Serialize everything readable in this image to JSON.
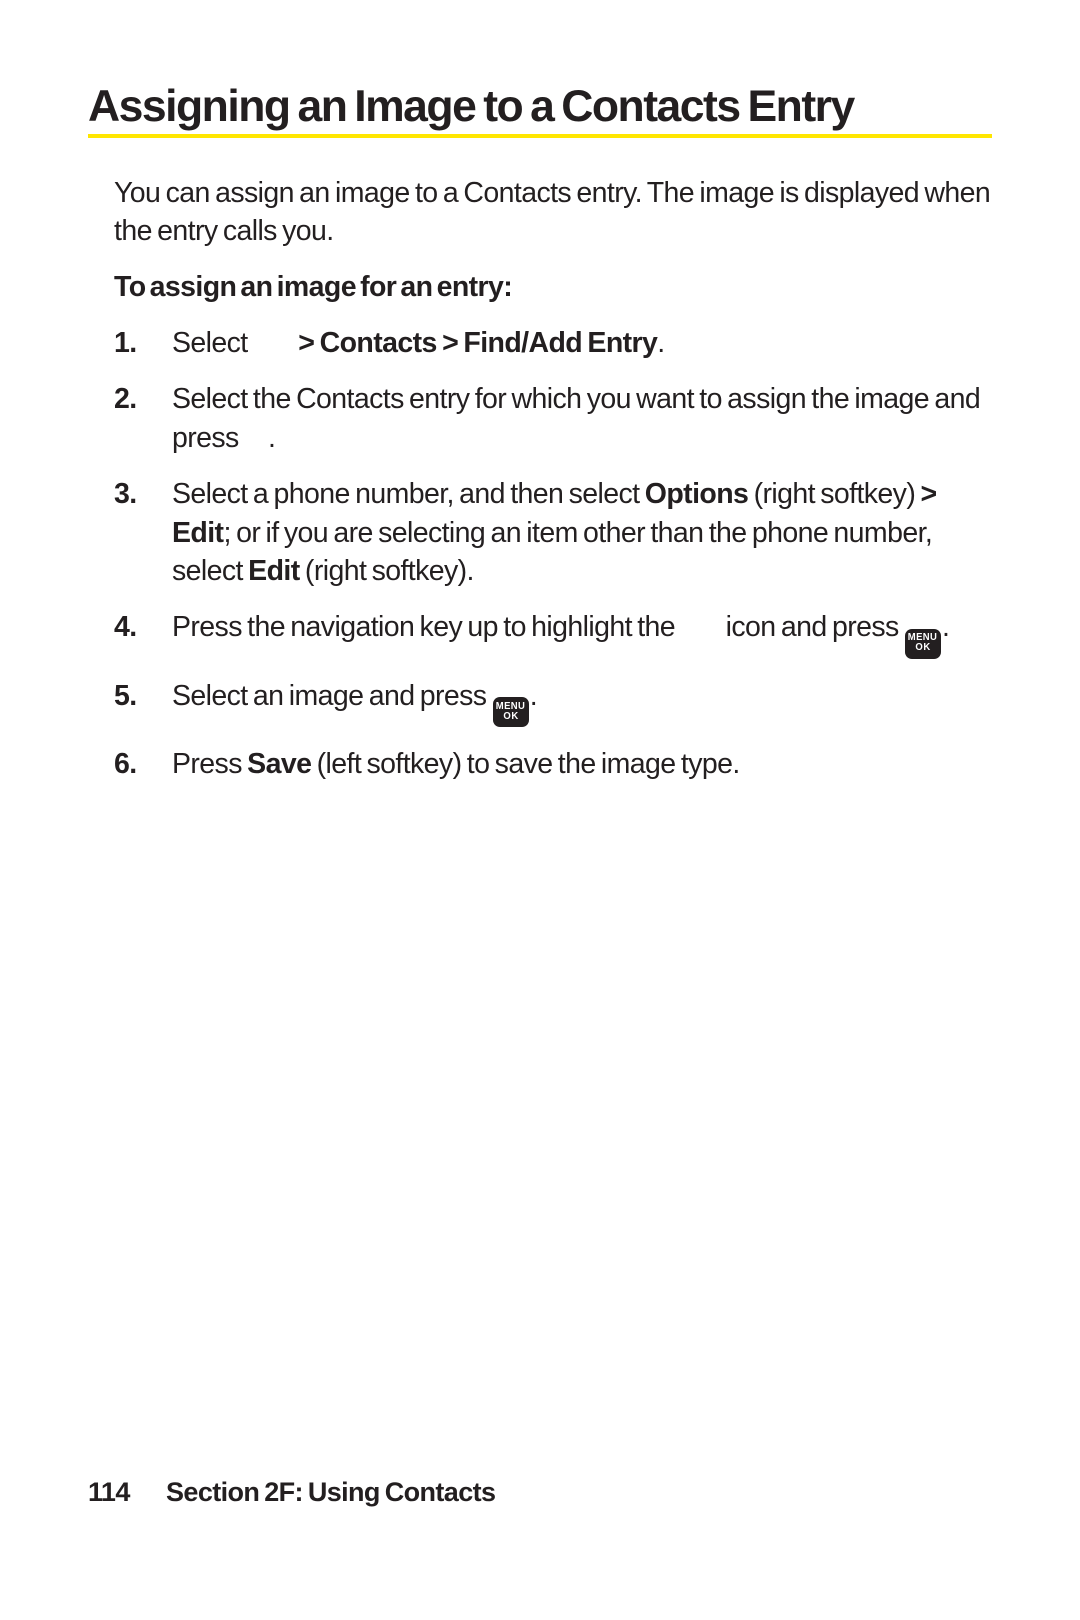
{
  "title": "Assigning an Image to a Contacts Entry",
  "intro": "You can assign an image to a Contacts entry. The image is displayed when the entry calls you.",
  "subheading": "To assign an image for an entry:",
  "menu_key": {
    "top": "MENU",
    "bottom": "OK"
  },
  "steps": {
    "s1": {
      "num": "1.",
      "pre": "Select ",
      "bold": " > Contacts > Find/Add Entry",
      "post": "."
    },
    "s2": {
      "num": "2.",
      "pre": "Select the Contacts entry for which you want to assign the image and press ",
      "post": "."
    },
    "s3": {
      "num": "3.",
      "t1": "Select a phone number, and then select ",
      "b1": "Options",
      "t2": " (right softkey) ",
      "b2": "> Edit",
      "t3": "; or if you are selecting an item other than the phone number, select ",
      "b3": "Edit",
      "t4": " (right softkey)."
    },
    "s4": {
      "num": "4.",
      "t1": "Press the navigation key up to highlight the ",
      "t2": " icon and press ",
      "t3": "."
    },
    "s5": {
      "num": "5.",
      "t1": "Select an image and press ",
      "t2": "."
    },
    "s6": {
      "num": "6.",
      "t1": "Press ",
      "b1": "Save",
      "t2": " (left softkey) to save the image type."
    }
  },
  "footer": {
    "page_number": "114",
    "section": "Section 2F: Using Contacts"
  }
}
